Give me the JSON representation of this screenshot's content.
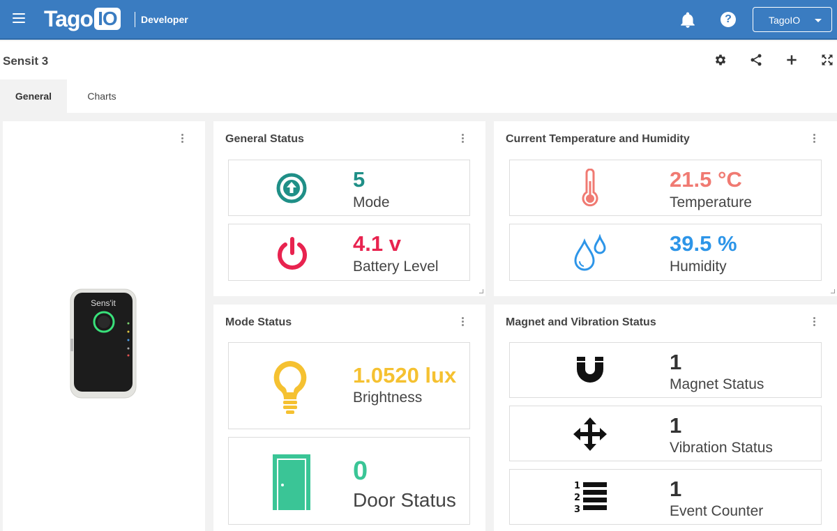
{
  "app": {
    "logo_text": "Tago",
    "logo_box": "IO",
    "subtitle": "Developer",
    "account": "TagoIO"
  },
  "page": {
    "title": "Sensit 3"
  },
  "tabs": [
    {
      "label": "General"
    },
    {
      "label": "Charts"
    }
  ],
  "device": {
    "brand": "Sens'it"
  },
  "widgets": {
    "general_status": {
      "title": "General Status",
      "items": [
        {
          "value": "5",
          "label": "Mode",
          "color": "#1f8f87",
          "icon": "arrow-up-circle-icon"
        },
        {
          "value": "4.1 v",
          "label": "Battery Level",
          "color": "#e8234f",
          "icon": "power-icon"
        }
      ]
    },
    "temp_humidity": {
      "title": "Current Temperature and Humidity",
      "items": [
        {
          "value": "21.5 °C",
          "label": "Temperature",
          "color": "#f07a72",
          "icon": "thermometer-icon"
        },
        {
          "value": "39.5 %",
          "label": "Humidity",
          "color": "#2d95e8",
          "icon": "water-drops-icon"
        }
      ]
    },
    "mode_status": {
      "title": "Mode Status",
      "items": [
        {
          "value": "1.0520 lux",
          "label": "Brightness",
          "color": "#f5c131",
          "icon": "lightbulb-icon"
        },
        {
          "value": "0",
          "label": "Door Status",
          "color": "#3ac596",
          "icon": "door-icon"
        }
      ]
    },
    "magnet_vibration": {
      "title": "Magnet and Vibration Status",
      "items": [
        {
          "value": "1",
          "label": "Magnet Status",
          "color": "#333333",
          "icon": "magnet-icon"
        },
        {
          "value": "1",
          "label": "Vibration Status",
          "color": "#333333",
          "icon": "move-arrows-icon"
        },
        {
          "value": "1",
          "label": "Event Counter",
          "color": "#333333",
          "icon": "numbered-list-icon"
        }
      ]
    }
  }
}
